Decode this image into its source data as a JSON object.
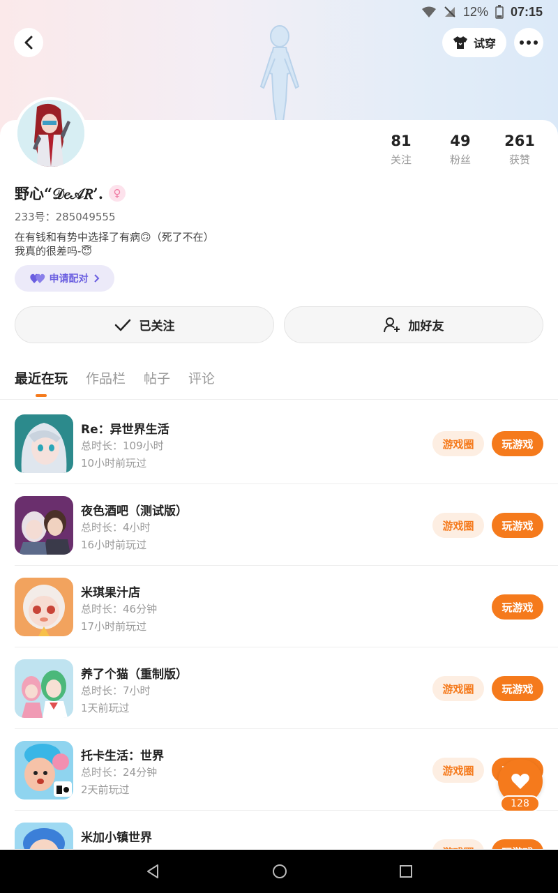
{
  "status_bar": {
    "battery": "12%",
    "time": "07:15"
  },
  "header": {
    "try_on_label": "试穿"
  },
  "profile": {
    "name": "野心“𝒟𝑒𝒜𝑅’.",
    "uid": "233号：285049555",
    "bio_line1": "在有钱和有势中选择了有病🙃（死了不在）",
    "bio_line2": "我真的很差吗-😇",
    "pair_label": "申请配对",
    "stats": [
      {
        "value": "81",
        "label": "关注"
      },
      {
        "value": "49",
        "label": "粉丝"
      },
      {
        "value": "261",
        "label": "获赞"
      }
    ],
    "follow_label": "已关注",
    "add_friend_label": "加好友"
  },
  "tabs": [
    {
      "label": "最近在玩",
      "active": true
    },
    {
      "label": "作品栏",
      "active": false
    },
    {
      "label": "帖子",
      "active": false
    },
    {
      "label": "评论",
      "active": false
    }
  ],
  "games": [
    {
      "title": "Re：异世界生活",
      "duration": "总时长：109小时",
      "last_played": "10小时前玩过",
      "circle_label": "游戏圈",
      "play_label": "玩游戏"
    },
    {
      "title": "夜色酒吧（测试版）",
      "duration": "总时长：4小时",
      "last_played": "16小时前玩过",
      "circle_label": "游戏圈",
      "play_label": "玩游戏"
    },
    {
      "title": "米琪果汁店",
      "duration": "总时长：46分钟",
      "last_played": "17小时前玩过",
      "circle_label": "",
      "play_label": "玩游戏"
    },
    {
      "title": "养了个猫（重制版）",
      "duration": "总时长：7小时",
      "last_played": "1天前玩过",
      "circle_label": "游戏圈",
      "play_label": "玩游戏"
    },
    {
      "title": "托卡生活：世界",
      "duration": "总时长：24分钟",
      "last_played": "2天前玩过",
      "circle_label": "游戏圈",
      "play_label": "玩游戏"
    },
    {
      "title": "米加小镇世界",
      "duration": "",
      "last_played": "",
      "circle_label": "游戏圈",
      "play_label": "玩游戏"
    }
  ],
  "floating_like": {
    "count": "128"
  },
  "colors": {
    "accent": "#f57a1c",
    "accent_light": "#fdeee2",
    "pair_bg": "#eceaf9",
    "pair_text": "#6a5ee0"
  }
}
